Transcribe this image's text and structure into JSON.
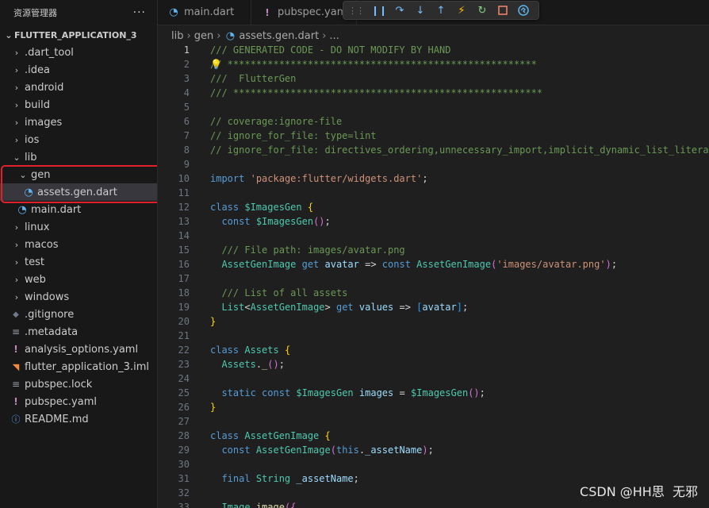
{
  "sidebar": {
    "title": "资源管理器",
    "more_label": "···",
    "project": "FLUTTER_APPLICATION_3",
    "items": [
      {
        "label": ".dart_tool",
        "kind": "folder",
        "depth": 1,
        "expanded": false
      },
      {
        "label": ".idea",
        "kind": "folder",
        "depth": 1,
        "expanded": false
      },
      {
        "label": "android",
        "kind": "folder",
        "depth": 1,
        "expanded": false
      },
      {
        "label": "build",
        "kind": "folder",
        "depth": 1,
        "expanded": false
      },
      {
        "label": "images",
        "kind": "folder",
        "depth": 1,
        "expanded": false
      },
      {
        "label": "ios",
        "kind": "folder",
        "depth": 1,
        "expanded": false
      },
      {
        "label": "lib",
        "kind": "folder",
        "depth": 1,
        "expanded": true
      },
      {
        "label": "gen",
        "kind": "folder",
        "depth": 2,
        "expanded": true
      },
      {
        "label": "assets.gen.dart",
        "kind": "dart",
        "depth": 3,
        "selected": true
      },
      {
        "label": "main.dart",
        "kind": "dart",
        "depth": 2
      },
      {
        "label": "linux",
        "kind": "folder",
        "depth": 1,
        "expanded": false
      },
      {
        "label": "macos",
        "kind": "folder",
        "depth": 1,
        "expanded": false
      },
      {
        "label": "test",
        "kind": "folder",
        "depth": 1,
        "expanded": false
      },
      {
        "label": "web",
        "kind": "folder",
        "depth": 1,
        "expanded": false
      },
      {
        "label": "windows",
        "kind": "folder",
        "depth": 1,
        "expanded": false
      },
      {
        "label": ".gitignore",
        "kind": "git",
        "depth": 1
      },
      {
        "label": ".metadata",
        "kind": "meta",
        "depth": 1
      },
      {
        "label": "analysis_options.yaml",
        "kind": "yaml",
        "depth": 1
      },
      {
        "label": "flutter_application_3.iml",
        "kind": "rss",
        "depth": 1
      },
      {
        "label": "pubspec.lock",
        "kind": "lock",
        "depth": 1
      },
      {
        "label": "pubspec.yaml",
        "kind": "yaml",
        "depth": 1
      },
      {
        "label": "README.md",
        "kind": "info",
        "depth": 1
      }
    ]
  },
  "tabs": [
    {
      "label": "main.dart",
      "icon": "dart-icon"
    },
    {
      "label": "pubspec.yam",
      "icon": "yaml-icon"
    }
  ],
  "debug_toolbar": {
    "buttons": [
      "pause-icon",
      "step-over-icon",
      "step-into-icon",
      "step-out-icon",
      "hot-reload-icon",
      "restart-icon",
      "stop-icon",
      "devtools-icon"
    ]
  },
  "breadcrumb": [
    "lib",
    "gen",
    "assets.gen.dart",
    "..."
  ],
  "editor": {
    "active_line": 1,
    "lines": [
      [
        [
          "c",
          "/// GENERATED CODE - DO NOT MODIFY BY HAND"
        ]
      ],
      [
        [
          "c",
          "// ******************************************************"
        ]
      ],
      [
        [
          "c",
          "///  FlutterGen"
        ]
      ],
      [
        [
          "c",
          "/// ******************************************************"
        ]
      ],
      [],
      [
        [
          "c",
          "// coverage:ignore-file"
        ]
      ],
      [
        [
          "c",
          "// ignore_for_file: type=lint"
        ]
      ],
      [
        [
          "c",
          "// ignore_for_file: directives_ordering,unnecessary_import,implicit_dynamic_list_literal"
        ]
      ],
      [],
      [
        [
          "k",
          "import"
        ],
        [
          "d",
          " "
        ],
        [
          "s",
          "'package:flutter/widgets.dart'"
        ],
        [
          "d",
          ";"
        ]
      ],
      [],
      [
        [
          "k",
          "class"
        ],
        [
          "d",
          " "
        ],
        [
          "t",
          "$ImagesGen"
        ],
        [
          "d",
          " "
        ],
        [
          "b",
          "{"
        ]
      ],
      [
        [
          "d",
          "  "
        ],
        [
          "k",
          "const"
        ],
        [
          "d",
          " "
        ],
        [
          "t",
          "$ImagesGen"
        ],
        [
          "p",
          "()"
        ],
        [
          "d",
          ";"
        ]
      ],
      [],
      [
        [
          "d",
          "  "
        ],
        [
          "c",
          "/// File path: images/avatar.png"
        ]
      ],
      [
        [
          "d",
          "  "
        ],
        [
          "t",
          "AssetGenImage"
        ],
        [
          "d",
          " "
        ],
        [
          "k",
          "get"
        ],
        [
          "d",
          " "
        ],
        [
          "v",
          "avatar"
        ],
        [
          "d",
          " => "
        ],
        [
          "k",
          "const"
        ],
        [
          "d",
          " "
        ],
        [
          "t",
          "AssetGenImage"
        ],
        [
          "p",
          "("
        ],
        [
          "s",
          "'images/avatar.png'"
        ],
        [
          "p",
          ")"
        ],
        [
          "d",
          ";"
        ]
      ],
      [],
      [
        [
          "d",
          "  "
        ],
        [
          "c",
          "/// List of all assets"
        ]
      ],
      [
        [
          "d",
          "  "
        ],
        [
          "t",
          "List"
        ],
        [
          "d",
          "<"
        ],
        [
          "t",
          "AssetGenImage"
        ],
        [
          "d",
          "> "
        ],
        [
          "k",
          "get"
        ],
        [
          "d",
          " "
        ],
        [
          "v",
          "values"
        ],
        [
          "d",
          " => "
        ],
        [
          "r",
          "["
        ],
        [
          "v",
          "avatar"
        ],
        [
          "r",
          "]"
        ],
        [
          "d",
          ";"
        ]
      ],
      [
        [
          "b",
          "}"
        ]
      ],
      [],
      [
        [
          "k",
          "class"
        ],
        [
          "d",
          " "
        ],
        [
          "t",
          "Assets"
        ],
        [
          "d",
          " "
        ],
        [
          "b",
          "{"
        ]
      ],
      [
        [
          "d",
          "  "
        ],
        [
          "t",
          "Assets"
        ],
        [
          "d",
          "."
        ],
        [
          "f",
          "_"
        ],
        [
          "p",
          "()"
        ],
        [
          "d",
          ";"
        ]
      ],
      [],
      [
        [
          "d",
          "  "
        ],
        [
          "k",
          "static"
        ],
        [
          "d",
          " "
        ],
        [
          "k",
          "const"
        ],
        [
          "d",
          " "
        ],
        [
          "t",
          "$ImagesGen"
        ],
        [
          "d",
          " "
        ],
        [
          "v",
          "images"
        ],
        [
          "d",
          " = "
        ],
        [
          "t",
          "$ImagesGen"
        ],
        [
          "p",
          "()"
        ],
        [
          "d",
          ";"
        ]
      ],
      [
        [
          "b",
          "}"
        ]
      ],
      [],
      [
        [
          "k",
          "class"
        ],
        [
          "d",
          " "
        ],
        [
          "t",
          "AssetGenImage"
        ],
        [
          "d",
          " "
        ],
        [
          "b",
          "{"
        ]
      ],
      [
        [
          "d",
          "  "
        ],
        [
          "k",
          "const"
        ],
        [
          "d",
          " "
        ],
        [
          "t",
          "AssetGenImage"
        ],
        [
          "p",
          "("
        ],
        [
          "k",
          "this"
        ],
        [
          "d",
          "."
        ],
        [
          "v",
          "_assetName"
        ],
        [
          "p",
          ")"
        ],
        [
          "d",
          ";"
        ]
      ],
      [],
      [
        [
          "d",
          "  "
        ],
        [
          "k",
          "final"
        ],
        [
          "d",
          " "
        ],
        [
          "t",
          "String"
        ],
        [
          "d",
          " "
        ],
        [
          "v",
          "_assetName"
        ],
        [
          "d",
          ";"
        ]
      ],
      [],
      [
        [
          "d",
          "  "
        ],
        [
          "t",
          "Image"
        ],
        [
          "d",
          " "
        ],
        [
          "f",
          "image"
        ],
        [
          "p",
          "({"
        ]
      ]
    ]
  },
  "watermark": "CSDN @HH思  无邪"
}
